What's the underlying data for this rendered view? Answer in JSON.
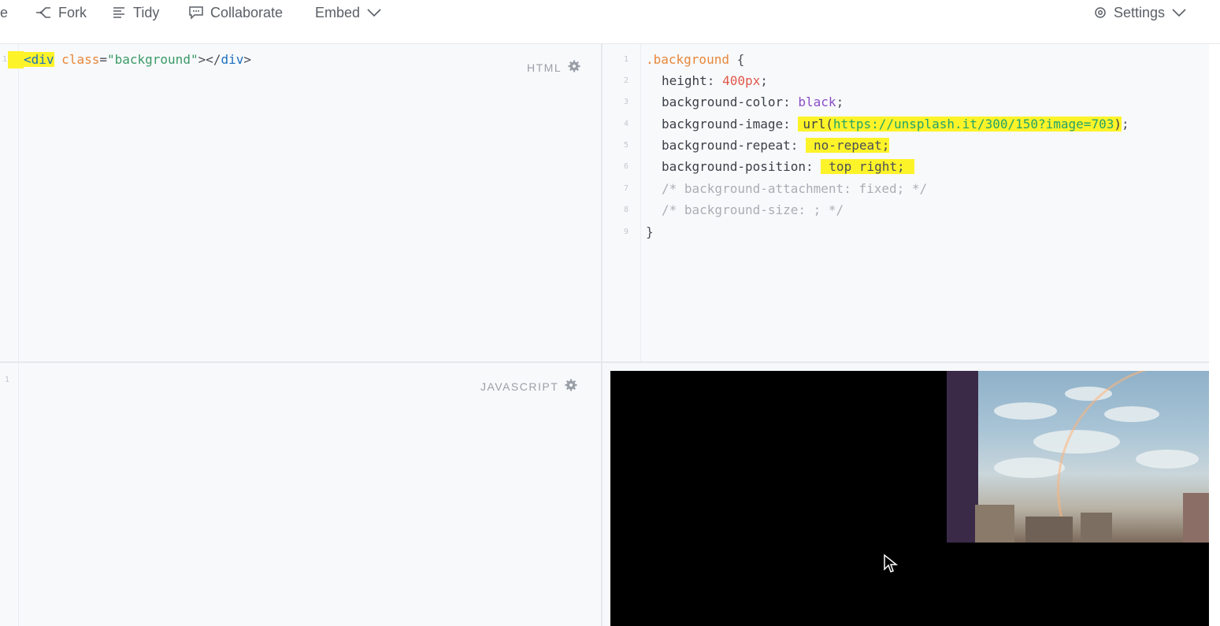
{
  "toolbar": {
    "partial_label": "e",
    "fork_label": "Fork",
    "tidy_label": "Tidy",
    "collaborate_label": "Collaborate",
    "embed_label": "Embed",
    "settings_label": "Settings"
  },
  "html_panel": {
    "label": "HTML",
    "line_number": "1",
    "code": {
      "open_tag": "<div",
      "space": " ",
      "attr_name": "class",
      "equals": "=",
      "attr_value": "\"background\"",
      "close_open": "></",
      "close_tag": "div",
      "end": ">"
    }
  },
  "css_panel": {
    "lines": [
      {
        "n": "1",
        "selector": ".background",
        "rest": " {"
      },
      {
        "n": "2",
        "prop": "height",
        "value": "400px",
        "end": ";"
      },
      {
        "n": "3",
        "prop": "background-color",
        "value": "black",
        "end": ";"
      },
      {
        "n": "4",
        "prop": "background-image",
        "url_fn": "url(",
        "url": "https://unsplash.it/300/150?image=703",
        "url_close": ")",
        "end": ";"
      },
      {
        "n": "5",
        "prop": "background-repeat",
        "value": "no-repeat;"
      },
      {
        "n": "6",
        "prop": "background-position",
        "value": "top right;"
      },
      {
        "n": "7",
        "comment": "/* background-attachment: fixed; */"
      },
      {
        "n": "8",
        "comment": "/* background-size: ; */"
      },
      {
        "n": "9",
        "brace": "}"
      }
    ]
  },
  "js_panel": {
    "label": "JAVASCRIPT",
    "line_number": "1"
  },
  "icons": {
    "fork": "fork-icon",
    "tidy": "tidy-icon",
    "collaborate": "chat-icon",
    "embed": "chevron-down-icon",
    "settings": "gear-icon",
    "panel_settings": "gear-icon",
    "cursor": "mouse-cursor-icon"
  },
  "colors": {
    "highlight": "#fdf329",
    "preview_background": "#000000"
  }
}
